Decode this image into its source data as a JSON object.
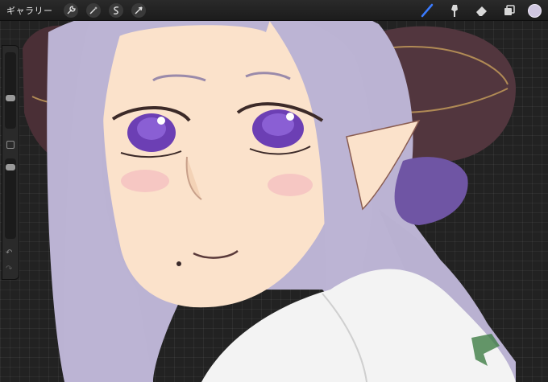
{
  "topbar": {
    "gallery_label": "ギャラリー",
    "left_tools": [
      {
        "icon": "wrench-icon",
        "name": "actions-button"
      },
      {
        "icon": "magic-wand-icon",
        "name": "adjustments-button"
      },
      {
        "icon": "selection-s-icon",
        "name": "selection-button"
      },
      {
        "icon": "arrow-cursor-icon",
        "name": "transform-button"
      }
    ],
    "right_tools": [
      {
        "icon": "brush-icon",
        "name": "brush-tool",
        "color": "#3a7bff"
      },
      {
        "icon": "smudge-icon",
        "name": "smudge-tool"
      },
      {
        "icon": "eraser-icon",
        "name": "eraser-tool"
      },
      {
        "icon": "layers-icon",
        "name": "layers-button"
      }
    ],
    "active_color": "#cfc6e0"
  },
  "sidebar": {
    "brush_size_level": 0.35,
    "opacity_level": 0.05
  },
  "colors": {
    "hair": "#bcb4d4",
    "skin": "#fbe2cb",
    "horn": "#53373f",
    "eyes": "#6c3fb4",
    "scrunchie": "#6f55a4",
    "shirt": "#f3f3f3",
    "green_mark": "#3f7d45"
  }
}
